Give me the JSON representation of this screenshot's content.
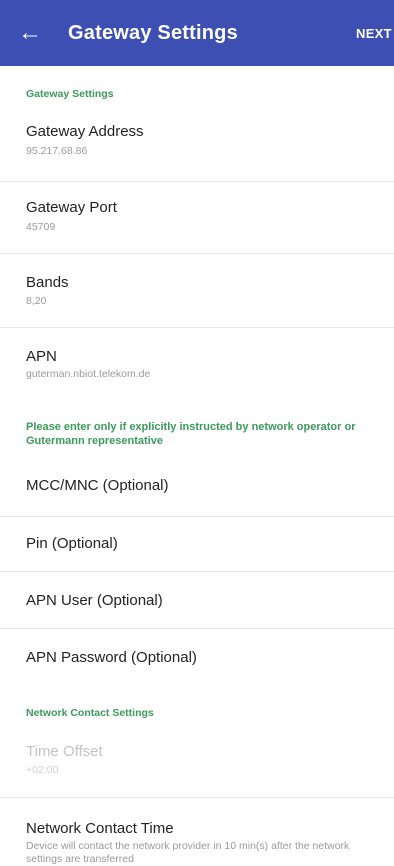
{
  "appbar": {
    "back_icon": "arrow-left-icon",
    "title": "Gateway Settings",
    "next_label": "NEXT"
  },
  "sections": {
    "gateway_header": "Gateway Settings",
    "network_header": "Network Contact Settings"
  },
  "fields": {
    "gateway_address": {
      "label": "Gateway Address",
      "value": "95.217.68.86"
    },
    "gateway_port": {
      "label": "Gateway Port",
      "value": "45709"
    },
    "bands": {
      "label": "Bands",
      "value": "8,20"
    },
    "apn": {
      "label": "APN",
      "value": "guterman.nbiot.telekom.de"
    },
    "mcc_mnc": {
      "label": "MCC/MNC (Optional)"
    },
    "pin": {
      "label": "Pin (Optional)"
    },
    "apn_user": {
      "label": "APN User (Optional)"
    },
    "apn_password": {
      "label": "APN Password (Optional)"
    },
    "time_offset": {
      "label": "Time Offset",
      "value": "+02:00"
    },
    "network_contact_time": {
      "label": "Network Contact Time",
      "description": "Device will contact the network provider in 10 min(s) after the network settings are transferred"
    }
  },
  "notes": {
    "optional_notice": "Please enter only if explicitly instructed by network operator or Gutermann representative"
  },
  "colors": {
    "appbar": "#3d4fb3",
    "accent_green": "#3c9a5c"
  }
}
